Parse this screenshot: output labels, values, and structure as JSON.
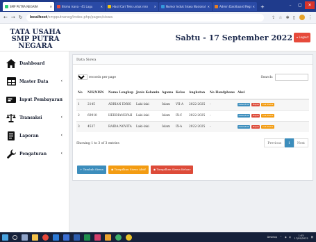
{
  "browser": {
    "tabs": [
      {
        "label": "SMP PUTRA NEGARA",
        "color": "#2ecc71",
        "active": true
      },
      {
        "label": "Bisma isana - 41 Lagu",
        "color": "#e74c3c",
        "active": false
      },
      {
        "label": "Hasil Cari Teks untuk nisn",
        "color": "#f1c40f",
        "active": false
      },
      {
        "label": "Nomor Induk Siswa Nasional",
        "color": "#3498db",
        "active": false
      },
      {
        "label": "Admin Dashboard Regi",
        "color": "#e67e22",
        "active": false
      }
    ],
    "url_host": "localhost",
    "url_path": "/smpputraneg/index.php/pages/siswa"
  },
  "header": {
    "brand": "TATA USAHA SMP PUTRA NEGARA",
    "date": "Sabtu - 17 September 2022",
    "logout_label": "Logout"
  },
  "sidebar": {
    "items": [
      {
        "label": "Dashboard",
        "icon": "home-icon",
        "chevron": false
      },
      {
        "label": "Master Data",
        "icon": "table-icon",
        "chevron": true
      },
      {
        "label": "Input Pembayaran",
        "icon": "money-icon",
        "chevron": true
      },
      {
        "label": "Transaksi",
        "icon": "balance-scale-icon",
        "chevron": true
      },
      {
        "label": "Laporan",
        "icon": "file-icon",
        "chevron": true
      },
      {
        "label": "Pengaturan",
        "icon": "wrench-icon",
        "chevron": true
      }
    ]
  },
  "main": {
    "panel_title": "Data Siswa",
    "length_value": "10",
    "length_suffix": "records per page",
    "search_label": "Search:",
    "search_value": "",
    "columns": [
      "No",
      "NIS/NISN",
      "Nama Lengkap",
      "Jenis Kelamin",
      "Agama",
      "Kelas",
      "Angkatan",
      "No Handphone",
      "Aksi"
    ],
    "rows": [
      [
        "1",
        "2145",
        "ADRIAN IDRIS",
        "Laki-laki",
        "Islam",
        "VII-A",
        "2022-2025",
        "-"
      ],
      [
        "2",
        "69910",
        "HERDIANSYAH",
        "Laki-laki",
        "Islam",
        "IX-C",
        "2022-2025",
        "-"
      ],
      [
        "3",
        "4537",
        "RAIDA NOVITA",
        "Laki-laki",
        "Islam",
        "IX-A",
        "2022-2025",
        "-"
      ]
    ],
    "row_actions": [
      "Detail/Edit",
      "Hapus",
      "Cek Status"
    ],
    "info": "Showing 1 to 3 of 3 entries",
    "pager": {
      "prev": "Previous",
      "page": "1",
      "next": "Next"
    },
    "buttons": {
      "add": "+ Tambah Siswa",
      "active": "Tampilkan Siswa Aktif",
      "exit": "Tampilkan Siswa Keluar"
    }
  },
  "taskbar": {
    "lang": "Desktop",
    "time": "1:05",
    "date": "17/09/2022"
  },
  "colors": {
    "primary": "#3c8dbc",
    "danger": "#dd4b39",
    "warning": "#f39c12",
    "brand_text": "#1d2a4d"
  }
}
